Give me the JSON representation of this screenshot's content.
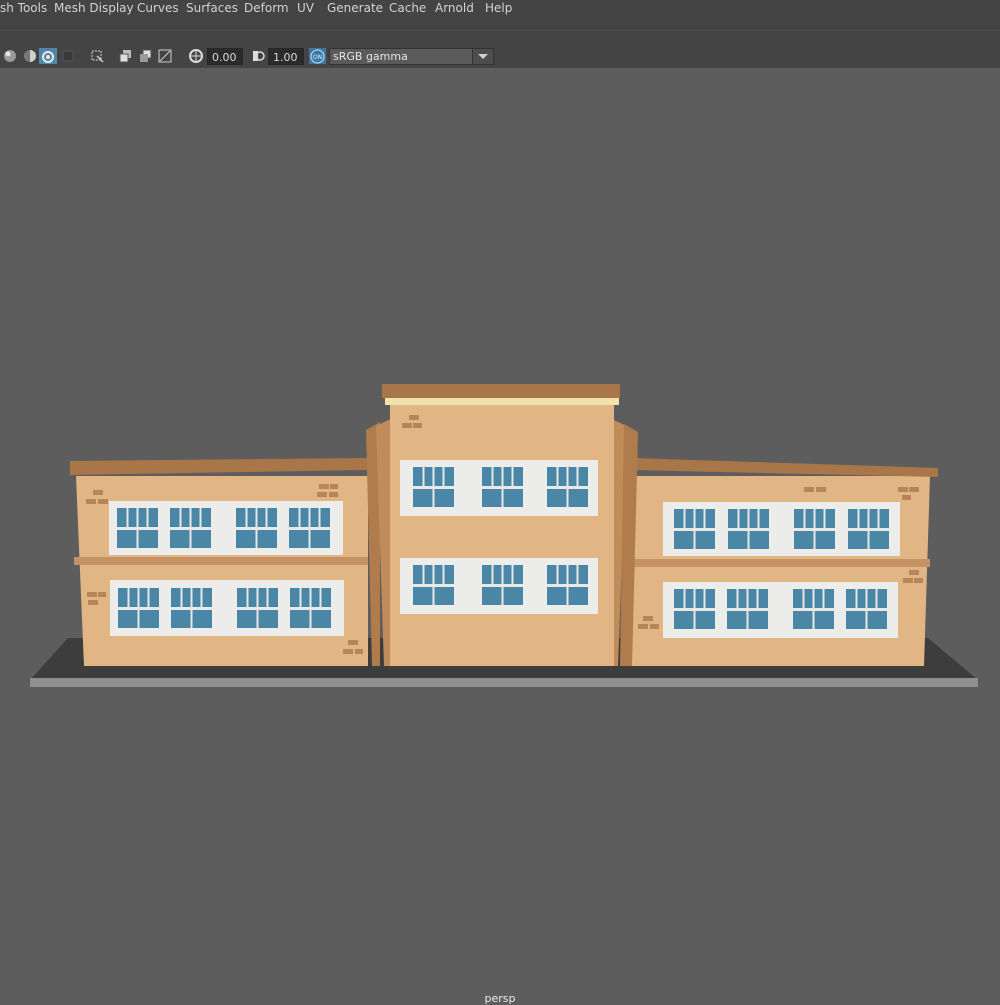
{
  "menubar": {
    "items": [
      {
        "key": "mesh_tools",
        "label": "sh Tools"
      },
      {
        "key": "mesh_display",
        "label": "Mesh Display"
      },
      {
        "key": "curves",
        "label": "Curves"
      },
      {
        "key": "surfaces",
        "label": "Surfaces"
      },
      {
        "key": "deform",
        "label": "Deform"
      },
      {
        "key": "uv",
        "label": "UV"
      },
      {
        "key": "generate",
        "label": "Generate"
      },
      {
        "key": "cache",
        "label": "Cache"
      },
      {
        "key": "arnold",
        "label": "Arnold"
      },
      {
        "key": "help",
        "label": "Help"
      }
    ]
  },
  "toolbar": {
    "exposure_value": "0.00",
    "gamma_value": "1.00",
    "color_mgmt_badge": "ON",
    "colorspace_label": "sRGB gamma",
    "icons": [
      "shaded-sphere-icon",
      "lit-sphere-icon",
      "isolate-select-icon",
      "wireframe-toggle-icon",
      "xray-icon",
      "screen-space-ao-icon",
      "motion-blur-icon",
      "anti-alias-icon",
      "exposure-icon",
      "gamma-icon",
      "color-management-icon",
      "dropdown-arrow-icon"
    ]
  },
  "viewport": {
    "camera_label": "persp"
  },
  "colors": {
    "ui_bg": "#444444",
    "viewport_bg": "#5d5d5d",
    "wall": "#e2b584",
    "wall_shadow": "#cf9e6c",
    "roof": "#a87648",
    "window_glass": "#4a86a6",
    "window_frame": "#ececea",
    "brick": "#b8845a",
    "ground": "#3d3d3d"
  }
}
